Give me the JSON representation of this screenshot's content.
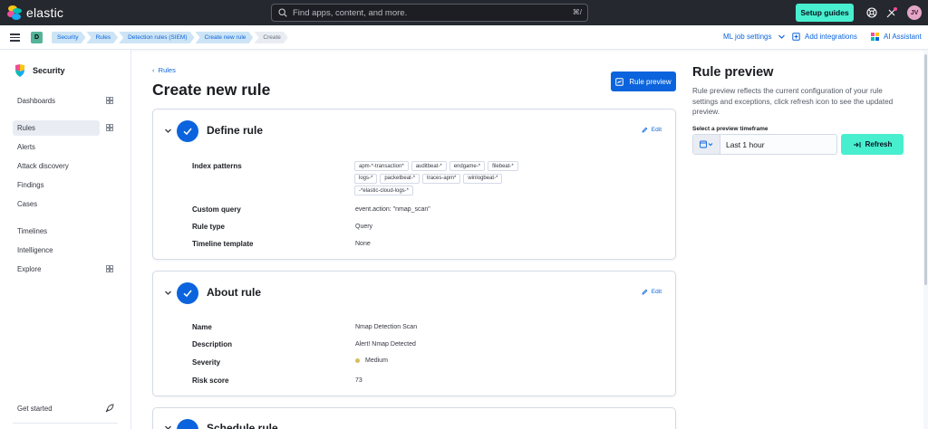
{
  "header": {
    "brand": "elastic",
    "search_placeholder": "Find apps, content, and more.",
    "search_shortcut": "⌘/",
    "setup_guides": "Setup guides",
    "avatar": "JV",
    "space": "D"
  },
  "breadcrumbs": [
    "Security",
    "Rules",
    "Detection rules (SIEM)",
    "Create new rule",
    "Create"
  ],
  "subbar": {
    "ml_job_settings": "ML job settings",
    "add_integrations": "Add integrations",
    "ai_assistant": "AI Assistant"
  },
  "sidebar": {
    "title": "Security",
    "items": [
      {
        "label": "Dashboards"
      },
      {
        "label": "Rules"
      },
      {
        "label": "Alerts"
      },
      {
        "label": "Attack discovery"
      },
      {
        "label": "Findings"
      },
      {
        "label": "Cases"
      },
      {
        "label": "Timelines"
      },
      {
        "label": "Intelligence"
      },
      {
        "label": "Explore"
      }
    ],
    "get_started": "Get started"
  },
  "main": {
    "back_link": "Rules",
    "title": "Create new rule",
    "rule_preview_button": "Rule preview",
    "define_rule": {
      "title": "Define rule",
      "edit": "Edit",
      "index_patterns_label": "Index patterns",
      "index_patterns": [
        "apm-*-transaction*",
        "auditbeat-*",
        "endgame-*",
        "filebeat-*",
        "logs-*",
        "packetbeat-*",
        "traces-apm*",
        "winlogbeat-*",
        "-*elastic-cloud-logs-*"
      ],
      "custom_query_label": "Custom query",
      "custom_query": "event.action: \"nmap_scan\"",
      "rule_type_label": "Rule type",
      "rule_type": "Query",
      "timeline_template_label": "Timeline template",
      "timeline_template": "None"
    },
    "about_rule": {
      "title": "About rule",
      "edit": "Edit",
      "name_label": "Name",
      "name": "Nmap Detection Scan",
      "description_label": "Description",
      "description": "Alert! Nmap Detected",
      "severity_label": "Severity",
      "severity": "Medium",
      "risk_score_label": "Risk score",
      "risk_score": "73"
    },
    "schedule_rule": {
      "title": "Schedule rule"
    }
  },
  "rule_preview": {
    "title": "Rule preview",
    "description": "Rule preview reflects the current configuration of your rule settings and exceptions, click refresh icon to see the updated preview.",
    "timeframe_label": "Select a preview timeframe",
    "timeframe_value": "Last 1 hour",
    "refresh": "Refresh"
  },
  "colors": {
    "primary": "#0b64dd",
    "accent": "#48efcf",
    "header_bg": "#25282f",
    "severity_medium": "#d6bf57"
  }
}
